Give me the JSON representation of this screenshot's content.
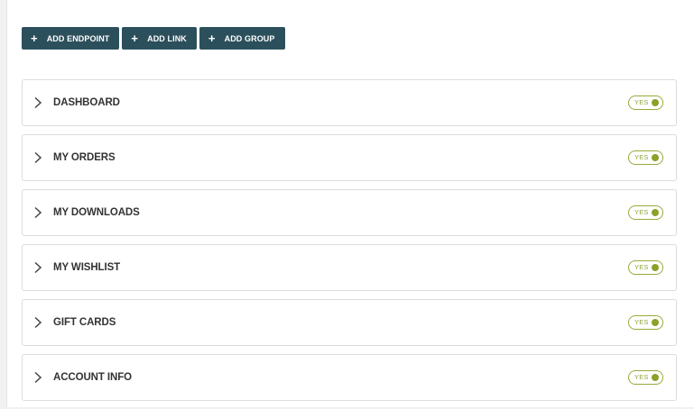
{
  "toolbar": {
    "add_endpoint_label": "ADD ENDPOINT",
    "add_link_label": "ADD LINK",
    "add_group_label": "ADD GROUP",
    "plus_glyph": "+"
  },
  "endpoints": [
    {
      "label": "DASHBOARD",
      "toggle": "YES",
      "enabled": true
    },
    {
      "label": "MY ORDERS",
      "toggle": "YES",
      "enabled": true
    },
    {
      "label": "MY DOWNLOADS",
      "toggle": "YES",
      "enabled": true
    },
    {
      "label": "MY WISHLIST",
      "toggle": "YES",
      "enabled": true
    },
    {
      "label": "GIFT CARDS",
      "toggle": "YES",
      "enabled": true
    },
    {
      "label": "ACCOUNT INFO",
      "toggle": "YES",
      "enabled": true
    }
  ],
  "colors": {
    "button_bg": "#2c4f5c",
    "toggle_accent": "#8aa12a",
    "item_border": "#dcdcdc"
  },
  "icons": {
    "expand": "chevron-right-icon",
    "add": "plus-icon"
  }
}
